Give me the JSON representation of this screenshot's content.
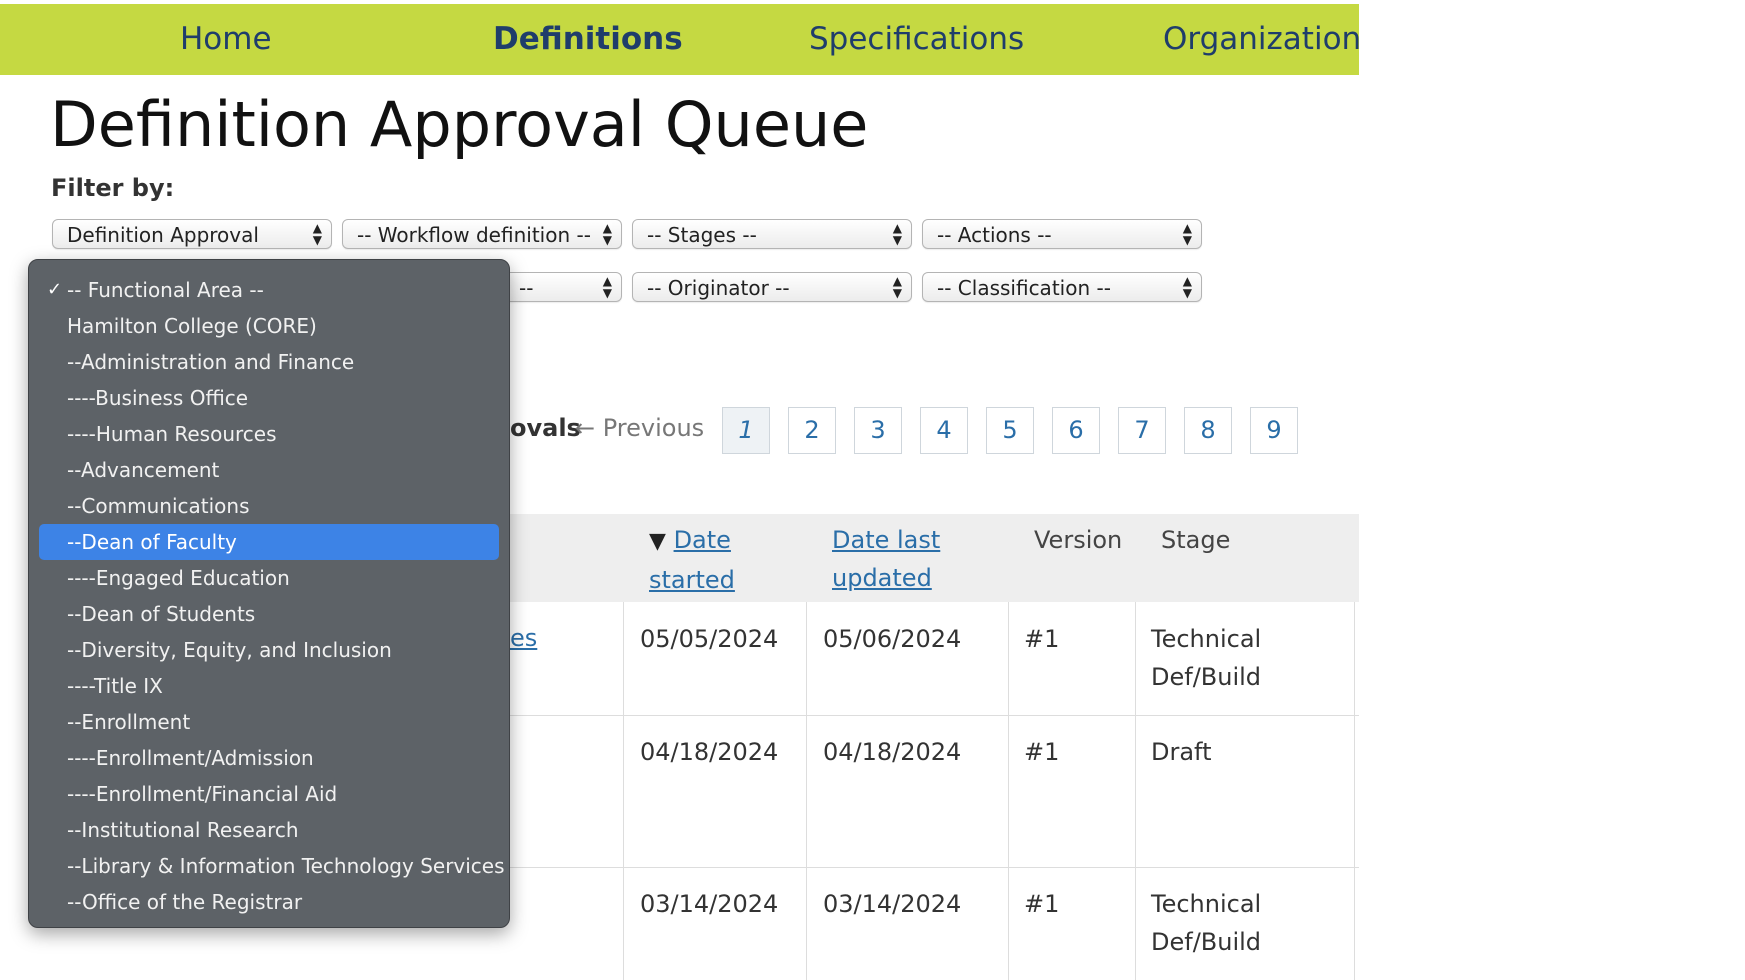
{
  "nav": {
    "items": [
      {
        "label": "Home",
        "active": false
      },
      {
        "label": "Definitions",
        "active": true
      },
      {
        "label": "Specifications",
        "active": false
      },
      {
        "label": "Organization",
        "active": false
      }
    ]
  },
  "page": {
    "title": "Definition Approval Queue",
    "filter_label": "Filter by:"
  },
  "filters": {
    "row1": [
      "Definition Approval",
      "-- Workflow definition --",
      "-- Stages --",
      "-- Actions --"
    ],
    "row2_partial": "--",
    "originator": "-- Originator --",
    "classification": "-- Classification --"
  },
  "pagination": {
    "lead_partial": "ovals",
    "previous": "← Previous",
    "pages": [
      "1",
      "2",
      "3",
      "4",
      "5",
      "6",
      "7",
      "8",
      "9"
    ],
    "current": "1"
  },
  "table": {
    "headers": {
      "date_started_line1": "Date",
      "date_started_line2": "started",
      "date_updated_line1": "Date last",
      "date_updated_line2": "updated",
      "version": "Version",
      "stage": "Stage",
      "sort_indicator": "▼"
    },
    "partial_link": "es",
    "rows": [
      {
        "date_started": "05/05/2024",
        "date_updated": "05/06/2024",
        "version": "#1",
        "stage_line1": "Technical",
        "stage_line2": "Def/Build"
      },
      {
        "date_started": "04/18/2024",
        "date_updated": "04/18/2024",
        "version": "#1",
        "stage_line1": "Draft",
        "stage_line2": ""
      },
      {
        "date_started": "03/14/2024",
        "date_updated": "03/14/2024",
        "version": "#1",
        "stage_line1": "Technical",
        "stage_line2": "Def/Build"
      }
    ]
  },
  "dropdown": {
    "checkmark": "✓",
    "selected_index": 7,
    "items": [
      "-- Functional Area --",
      "Hamilton College (CORE)",
      "--Administration and Finance",
      "----Business Office",
      "----Human Resources",
      "--Advancement",
      "--Communications",
      "--Dean of Faculty",
      "----Engaged Education",
      "--Dean of Students",
      "--Diversity, Equity, and Inclusion",
      "----Title IX",
      "--Enrollment",
      "----Enrollment/Admission",
      "----Enrollment/Financial Aid",
      "--Institutional Research",
      "--Library & Information Technology Services",
      "--Office of the Registrar"
    ]
  },
  "colors": {
    "nav_bg": "#c5d942",
    "nav_text": "#1f3d6b",
    "link": "#2a6ea8",
    "menu_bg": "#5d6267",
    "menu_selected": "#3d83e6"
  }
}
